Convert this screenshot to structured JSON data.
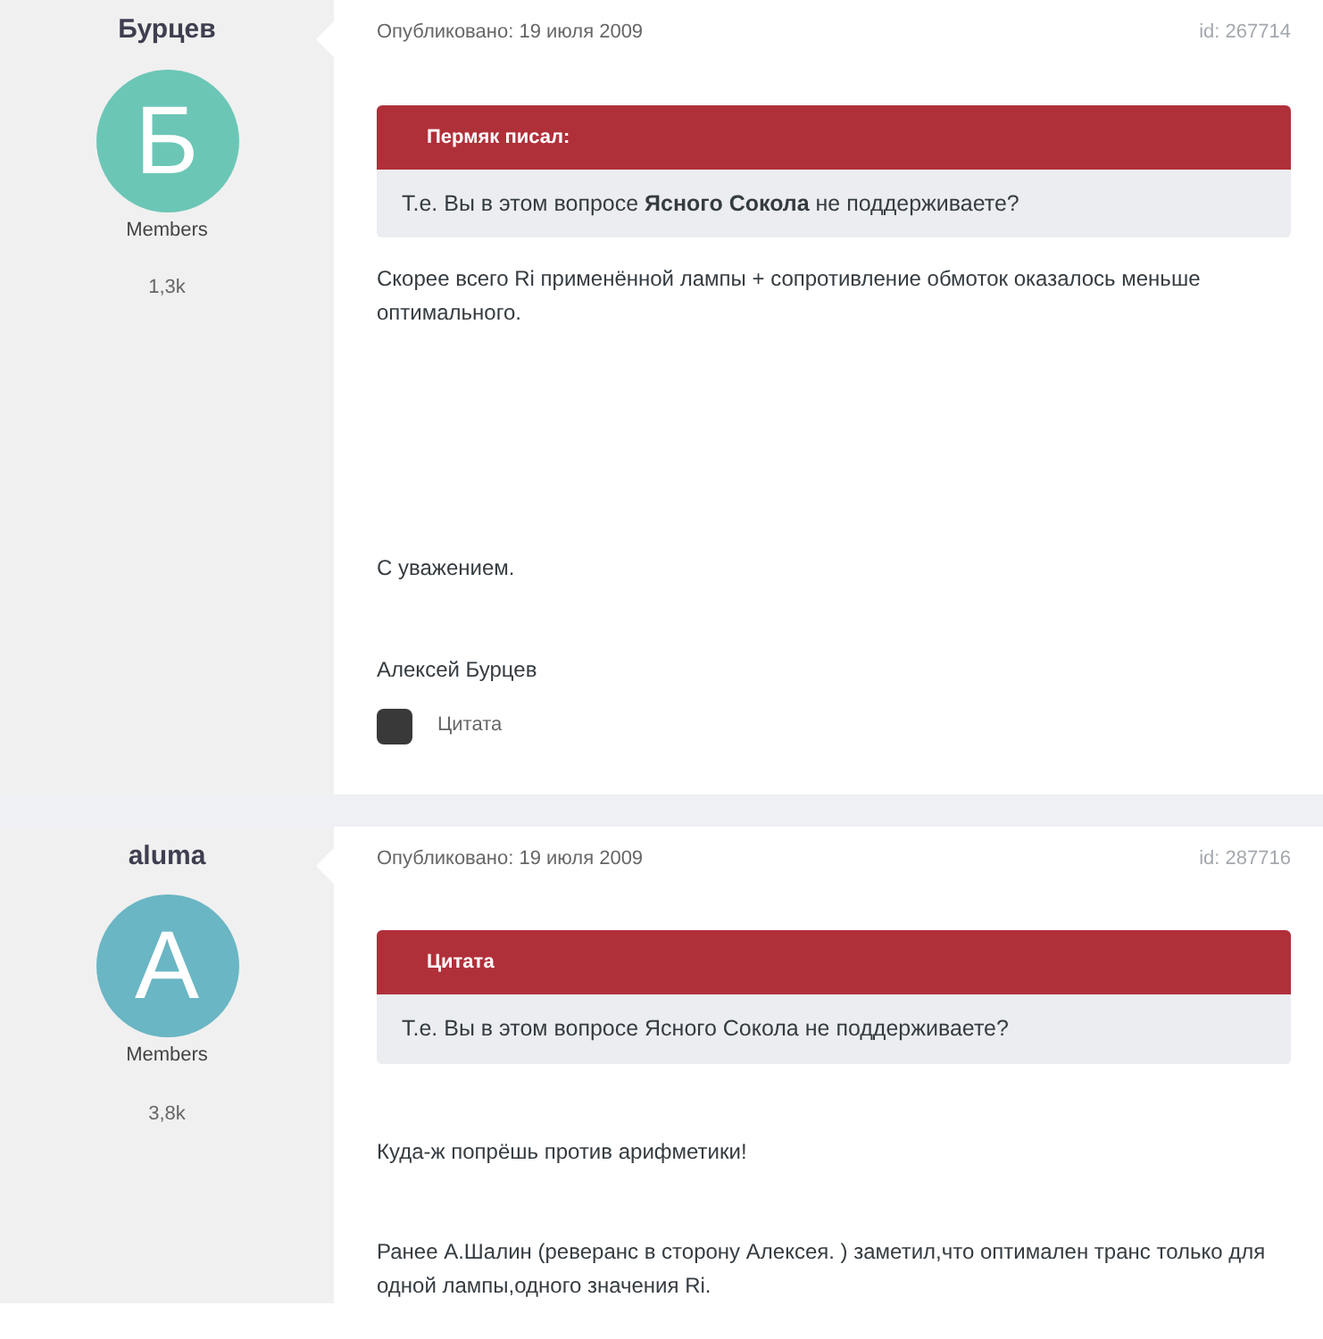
{
  "posts": [
    {
      "author": "Бурцев",
      "avatar_letter": "Б",
      "color": "#6cc6b6",
      "group": "Members",
      "count": "1,3k",
      "published": "Опубликовано: 19 июля 2009",
      "post_id": "id: 267714",
      "quote": {
        "header": "Пермяк писал:",
        "text": "Т.е. Вы в этом вопросе **Ясного Сокола** не поддерживаете?"
      },
      "paragraphs": [
        "Скорее всего Ri применённой лампы + сопротивление обмоток оказалось меньше оптимального.",
        "С уважением.",
        "Алексей Бурцев"
      ],
      "quote_button": "Цитата"
    },
    {
      "author": "aluma",
      "avatar_letter": "A",
      "color": "#6ab6c4",
      "group": "Members",
      "count": "3,8k",
      "published": "Опубликовано: 19 июля 2009",
      "post_id": "id: 287716",
      "quote": {
        "header": "Цитата",
        "text": "Т.е. Вы в этом вопросе Ясного Сокола не поддерживаете?"
      },
      "paragraphs": [
        "Куда-ж попрёшь против арифметики!",
        "Ранее А.Шалин (реверанс в сторону Алексея.  ) заметил,что оптимален транс только для одной лампы,одного значения Ri."
      ]
    }
  ]
}
